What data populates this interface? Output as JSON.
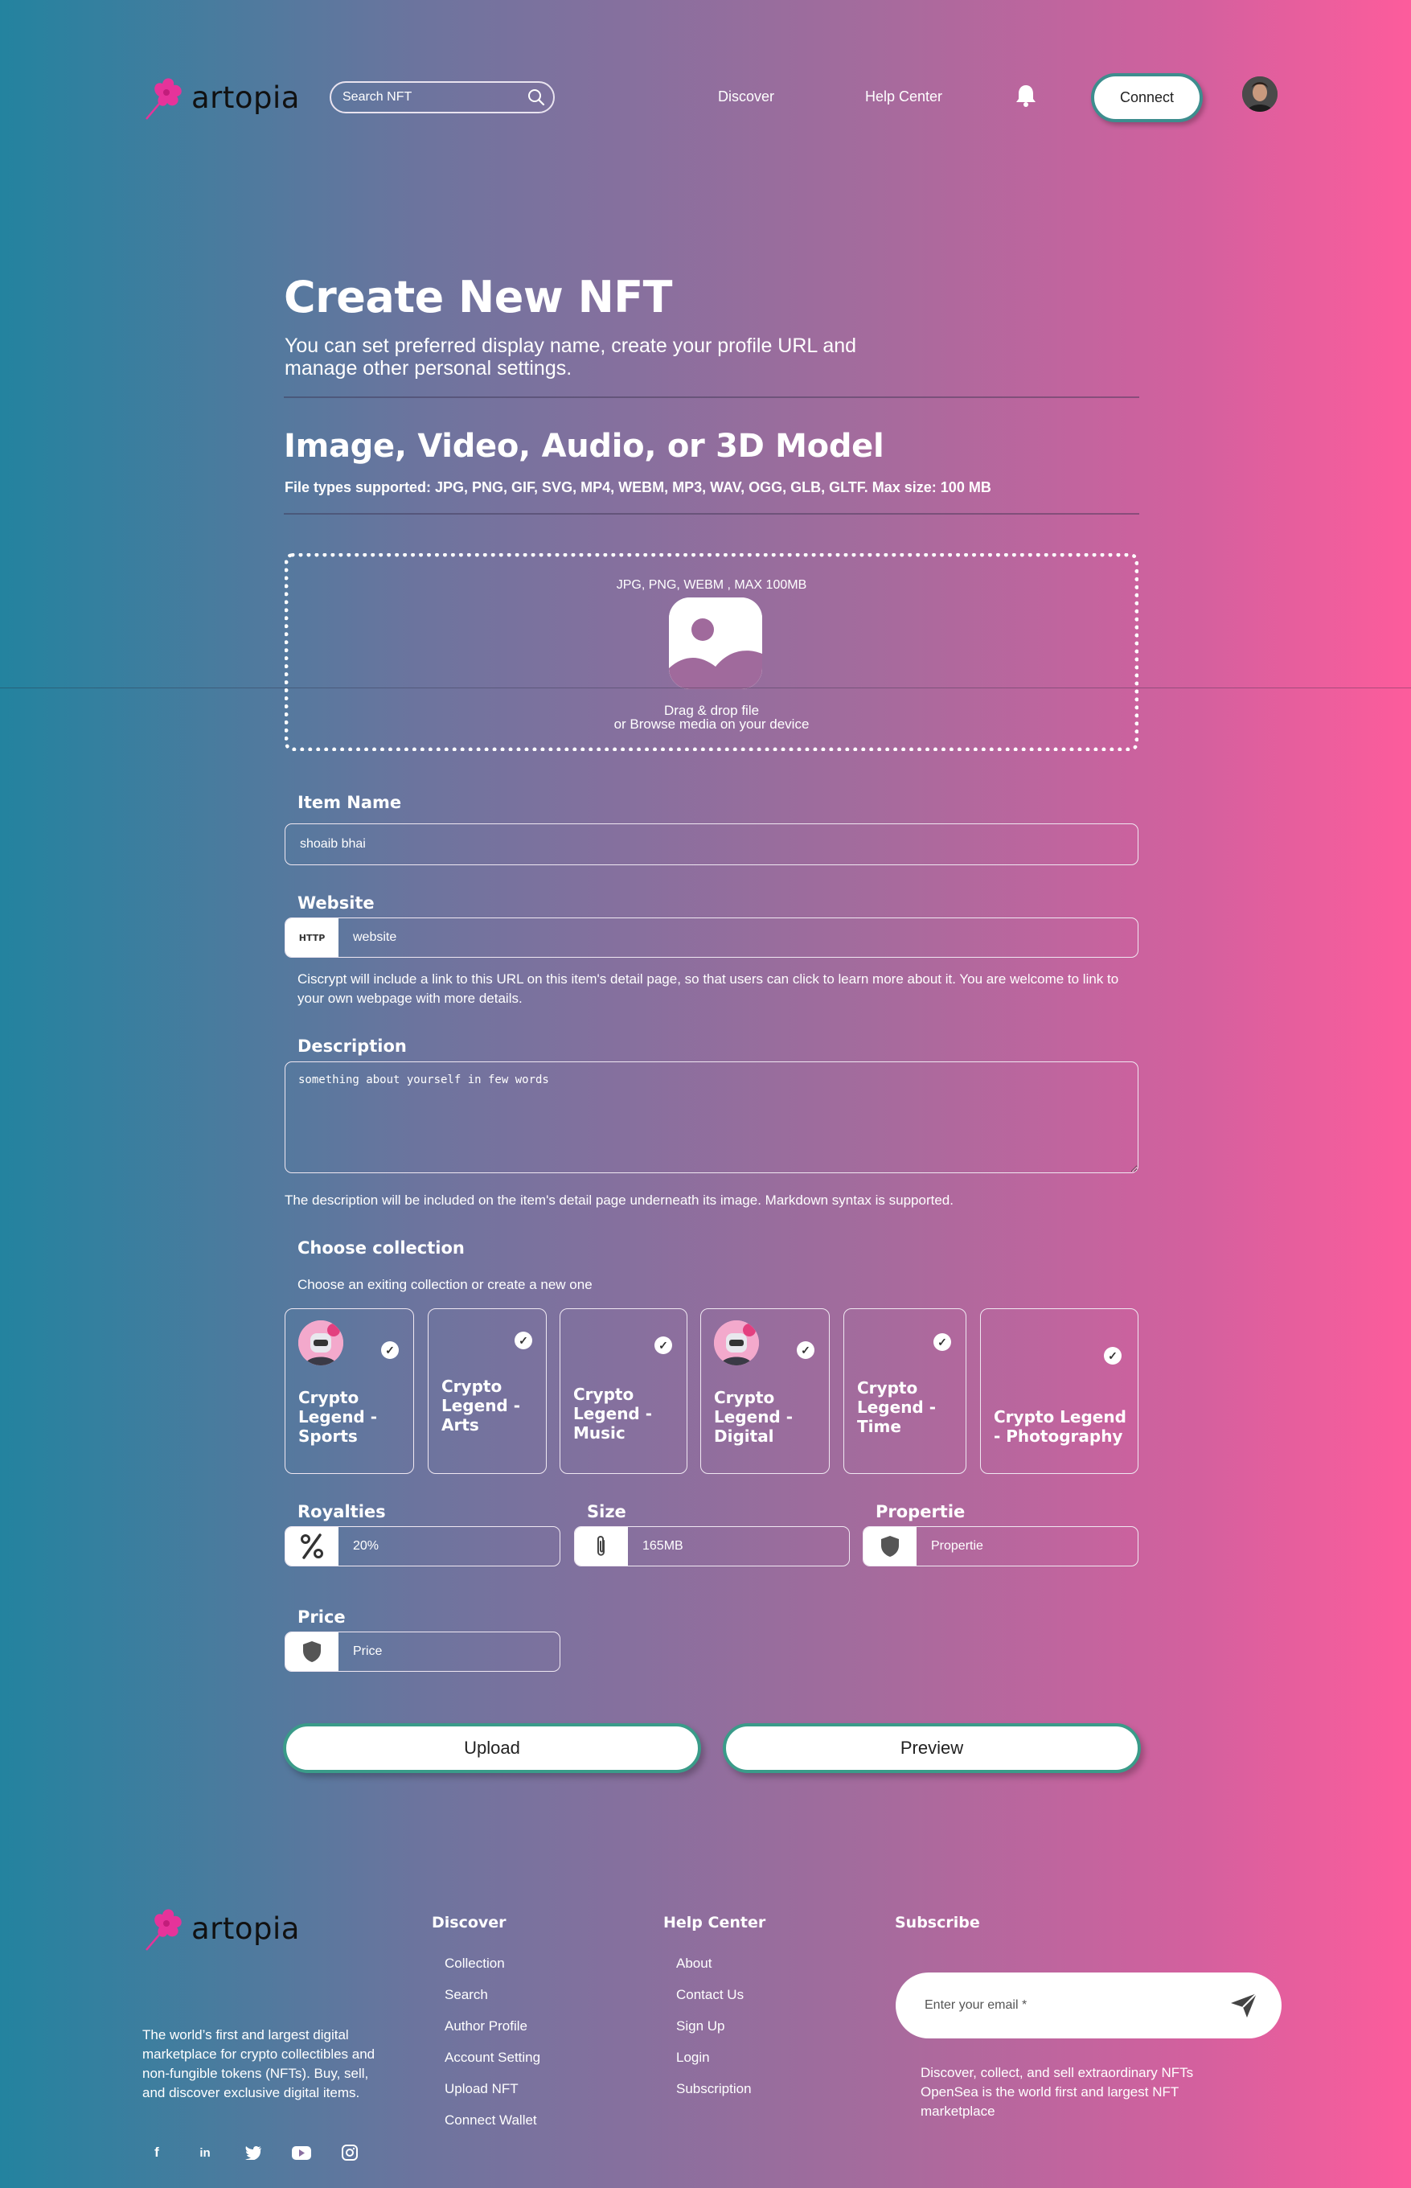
{
  "brand": {
    "name": "artopia",
    "accent": "#e6339a"
  },
  "header": {
    "search_placeholder": "Search NFT",
    "nav": [
      "Discover",
      "Help Center"
    ],
    "connect_label": "Connect"
  },
  "page": {
    "title": "Create New NFT",
    "subtitle": "You can set preferred display name, create your profile URL and manage other personal settings.",
    "media_title": "Image, Video, Audio, or 3D Model",
    "media_subtitle": "File types supported: JPG, PNG, GIF, SVG, MP4, WEBM, MP3, WAV, OGG, GLB, GLTF. Max size: 100 MB"
  },
  "dropzone": {
    "formats": "JPG, PNG, WEBM , MAX 100MB",
    "line1": "Drag & drop file",
    "line2": "or Browse media on your device"
  },
  "item_name": {
    "label": "Item Name",
    "value": "shoaib bhai"
  },
  "website": {
    "label": "Website",
    "prefix": "HTTP",
    "placeholder": "website",
    "help": "Ciscrypt will include a link to this URL on this item's detail page, so that users can click to learn more about it. You are welcome to link to your own webpage with more details."
  },
  "description": {
    "label": "Description",
    "placeholder": "something about yourself in few words",
    "help": "The description will be included on the item's detail page underneath its image. Markdown syntax is supported."
  },
  "collection": {
    "label": "Choose collection",
    "help": "Choose an exiting collection or create a new one",
    "items": [
      {
        "title": "Crypto Legend - Sports"
      },
      {
        "title": "Crypto Legend - Arts"
      },
      {
        "title": "Crypto Legend - Music"
      },
      {
        "title": "Crypto Legend - Digital"
      },
      {
        "title": "Crypto Legend - Time"
      },
      {
        "title": "Crypto Legend - Photography"
      }
    ]
  },
  "royalties": {
    "label": "Royalties",
    "placeholder": "20%"
  },
  "size": {
    "label": "Size",
    "placeholder": "165MB"
  },
  "properties": {
    "label": "Propertie",
    "placeholder": "Propertie"
  },
  "price": {
    "label": "Price",
    "placeholder": "Price"
  },
  "actions": {
    "upload": "Upload",
    "preview": "Preview"
  },
  "footer": {
    "description": "The world’s first and largest digital marketplace for crypto collectibles and non-fungible tokens (NFTs). Buy, sell, and discover exclusive digital items.",
    "discover": {
      "title": "Discover",
      "links": [
        "Collection",
        "Search",
        "Author Profile",
        "Account Setting",
        "Upload NFT",
        "Connect Wallet"
      ]
    },
    "help": {
      "title": "Help Center",
      "links": [
        "About",
        "Contact Us",
        "Sign Up",
        "Login",
        "Subscription"
      ]
    },
    "subscribe": {
      "title": "Subscribe",
      "placeholder": "Enter your email *",
      "text": "Discover, collect, and sell extraordinary NFTs OpenSea is the world first and largest NFT marketplace"
    },
    "social_icons": [
      "facebook-icon",
      "linkedin-icon",
      "twitter-icon",
      "youtube-icon",
      "instagram-icon"
    ]
  }
}
